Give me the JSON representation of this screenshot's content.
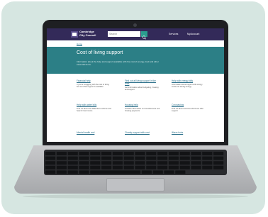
{
  "header": {
    "logo_text": "Cambridge\nCity Council",
    "search_placeholder": "Search",
    "nav_services": "Services",
    "nav_account": "MyAccount"
  },
  "breadcrumb": "Home",
  "hero": {
    "title": "Cost of living support",
    "text": "Information about the help and support available with the cost of energy, food and other essential items."
  },
  "cards": [
    {
      "title": "Financial help",
      "text": "If you're struggling with the cost of living find out what support is available."
    },
    {
      "title": "Find out all living support in the area",
      "text": "Get information about budgeting, housing and support."
    },
    {
      "title": "Help with energy bills",
      "text": "Information about support with energy costs and saving energy."
    },
    {
      "title": "Help with water bills",
      "text": "Find out about the WaterSure scheme and help for low income."
    },
    {
      "title": "Housing help",
      "text": "Includes information on homelessness and housing payments."
    },
    {
      "title": "Coronavirus",
      "text": "Find out about services which can offer support."
    },
    {
      "title": "Mental health and",
      "text": ""
    },
    {
      "title": "Charity support with cost",
      "text": ""
    },
    {
      "title": "Warm hubs",
      "text": ""
    }
  ],
  "colors": {
    "header_bg": "#332a59",
    "hero_bg": "#2c7f86",
    "frame_bg": "#d6e6e1",
    "accent": "#2a9d8f"
  }
}
